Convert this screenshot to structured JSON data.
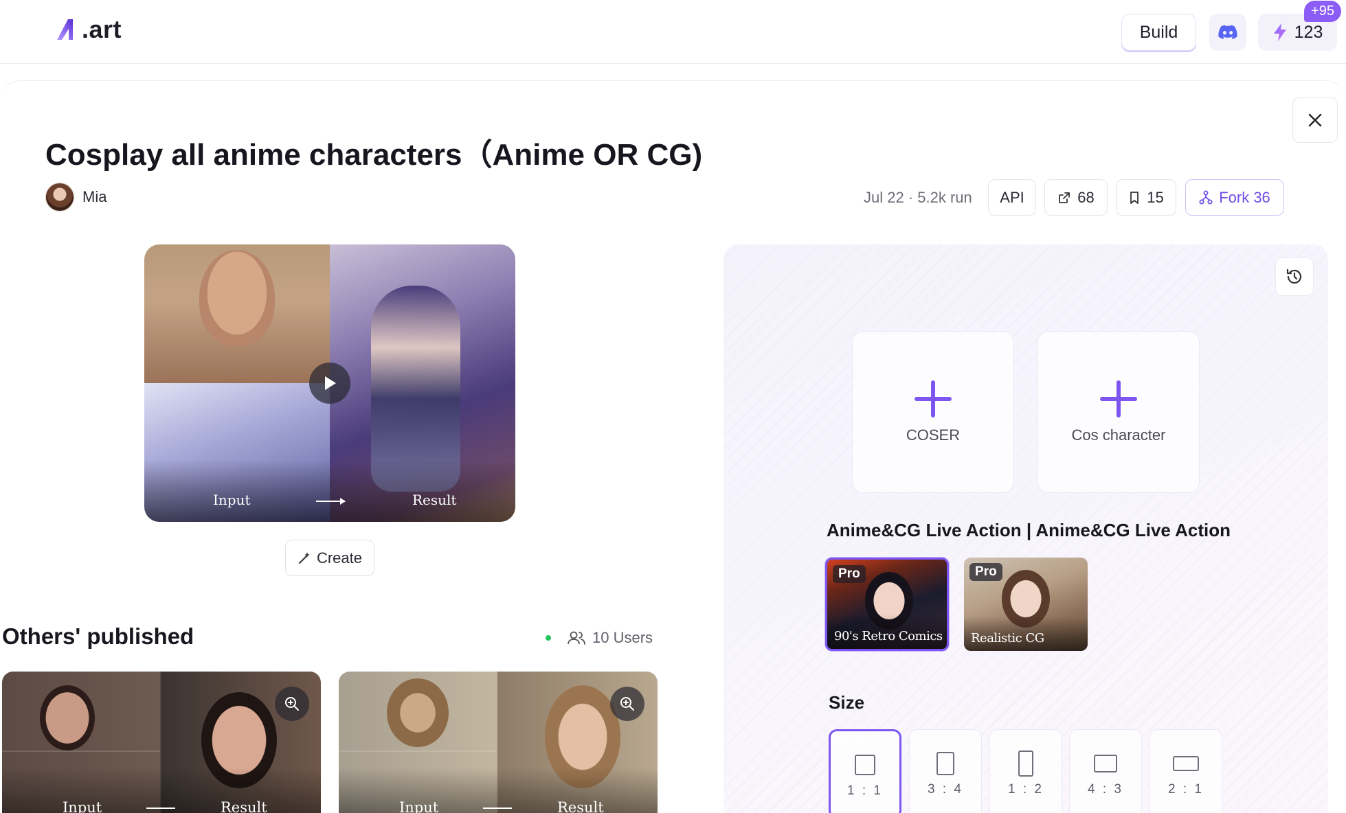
{
  "header": {
    "logo_text": ".art",
    "build_label": "Build",
    "credits_count": "123",
    "credits_badge": "+95"
  },
  "page": {
    "title": "Cosplay all anime characters（Anime OR CG)",
    "author_name": "Mia",
    "meta": "Jul 22 · 5.2k run",
    "api_label": "API",
    "share_count": "68",
    "save_count": "15",
    "fork_label": "Fork 36"
  },
  "preview": {
    "input_label": "Input",
    "result_label": "Result"
  },
  "create_label": "Create",
  "others": {
    "title": "Others' published",
    "users_label": "10 Users",
    "cards": [
      {
        "input_label": "Input",
        "result_label": "Result"
      },
      {
        "input_label": "Input",
        "result_label": "Result"
      }
    ]
  },
  "form": {
    "uploads": [
      {
        "label": "COSER"
      },
      {
        "label": "Cos character"
      }
    ],
    "model_section_title": "Anime&CG Live Action | Anime&CG Live Action",
    "models": [
      {
        "badge": "Pro",
        "label": "90's Retro Comics",
        "selected": true
      },
      {
        "badge": "Pro",
        "label": "Realistic CG",
        "selected": false
      }
    ],
    "size_title": "Size",
    "sizes": [
      {
        "label": "1 : 1",
        "selected": true
      },
      {
        "label": "3 : 4",
        "selected": false
      },
      {
        "label": "1 : 2",
        "selected": false
      },
      {
        "label": "4 : 3",
        "selected": false
      },
      {
        "label": "2 : 1",
        "selected": false
      }
    ]
  },
  "colors": {
    "accent": "#7d55f0",
    "badge": "#8b5cf6",
    "online_dot": "#22c55e"
  },
  "icons": [
    "logo-icon",
    "discord-icon",
    "lightning-icon",
    "close-icon",
    "share-icon",
    "bookmark-icon",
    "fork-icon",
    "play-icon",
    "magic-wand-icon",
    "users-icon",
    "zoom-in-icon",
    "history-icon",
    "plus-icon"
  ]
}
